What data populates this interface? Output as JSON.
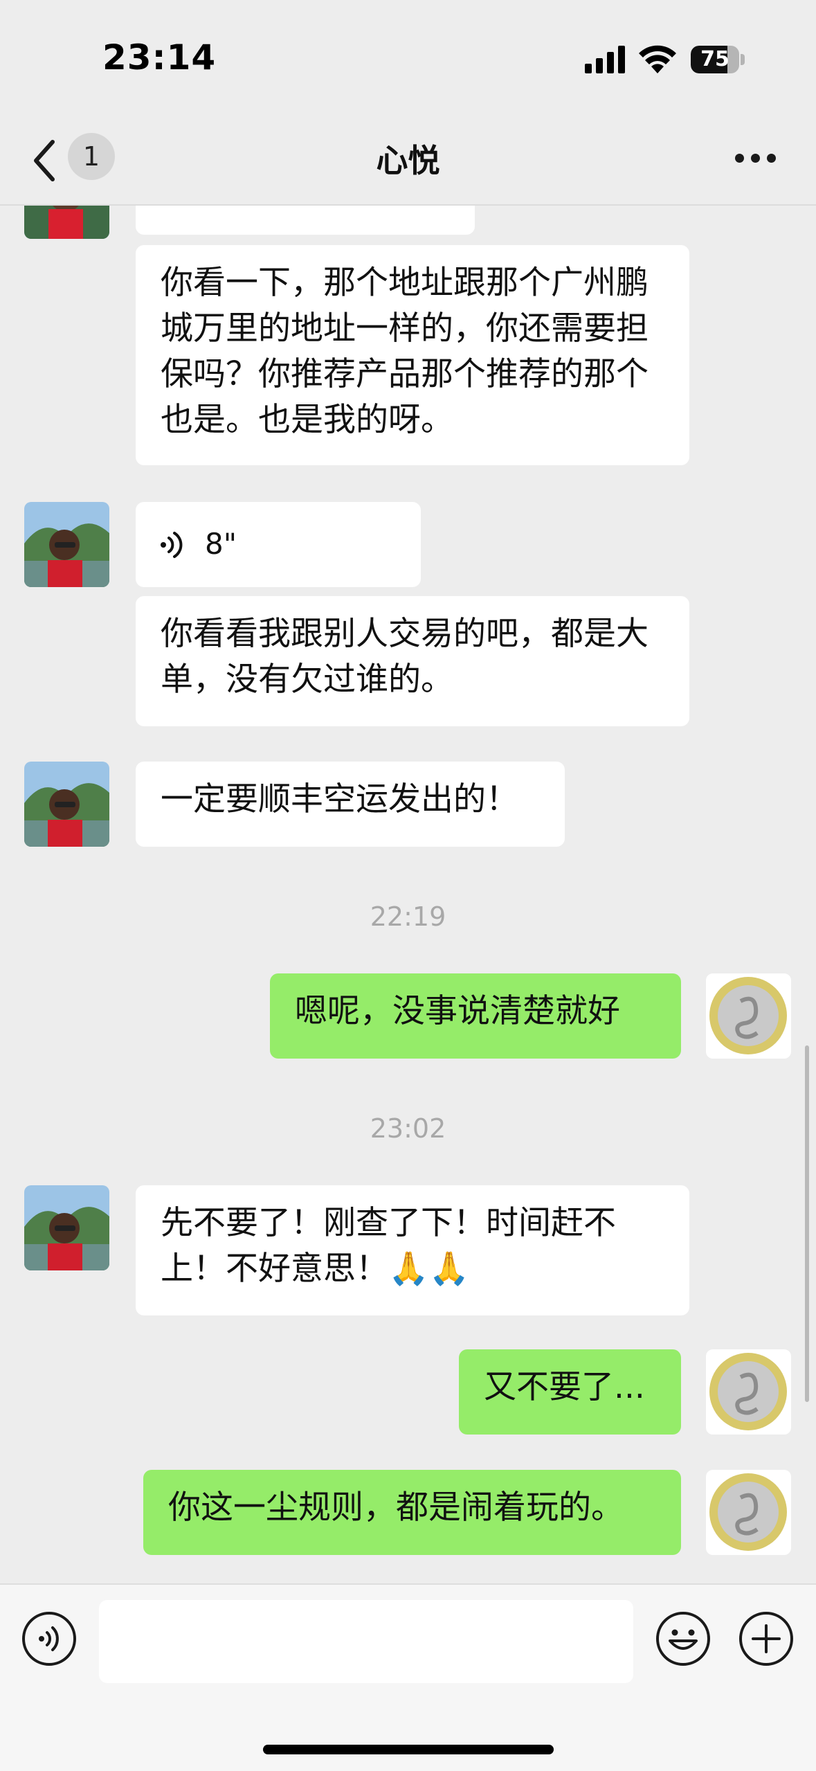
{
  "status_bar": {
    "time": "23:14",
    "battery_level": "75",
    "battery_fraction": 0.75,
    "icons": [
      "cellular-signal-icon",
      "wifi-icon",
      "battery-icon"
    ]
  },
  "nav": {
    "back_icon": "chevron-left-icon",
    "unread_badge": "1",
    "title": "心悦",
    "more_icon": "ellipsis-icon"
  },
  "messages": [
    {
      "side": "in",
      "kind": "text",
      "text": "你看一下，那个地址跟那个广州鹏城万里的地址一样的，你还需要担保吗？你推荐产品那个推荐的那个也是。也是我的呀。"
    },
    {
      "side": "in",
      "kind": "voice",
      "duration": "8\""
    },
    {
      "side": "in",
      "kind": "text",
      "text": "你看看我跟别人交易的吧，都是大单，没有欠过谁的。"
    },
    {
      "side": "in",
      "kind": "text",
      "text": "一定要顺丰空运发出的！"
    },
    {
      "kind": "timestamp",
      "text": "22:19"
    },
    {
      "side": "out",
      "kind": "text",
      "text": "嗯呢，没事说清楚就好"
    },
    {
      "kind": "timestamp",
      "text": "23:02"
    },
    {
      "side": "in",
      "kind": "text",
      "text": "先不要了！刚查了下！时间赶不上！不好意思！🙏🙏"
    },
    {
      "side": "out",
      "kind": "text",
      "text": "又不要了..."
    },
    {
      "side": "out",
      "kind": "text",
      "text": "你这一尘规则，都是闹着玩的。"
    }
  ],
  "input_bar": {
    "voice_icon": "voice-input-icon",
    "emoji_icon": "emoji-icon",
    "plus_icon": "plus-icon"
  },
  "colors": {
    "background": "#ededed",
    "bubble_in": "#ffffff",
    "bubble_out": "#95ec69",
    "timestamp": "#a8a8a8"
  }
}
